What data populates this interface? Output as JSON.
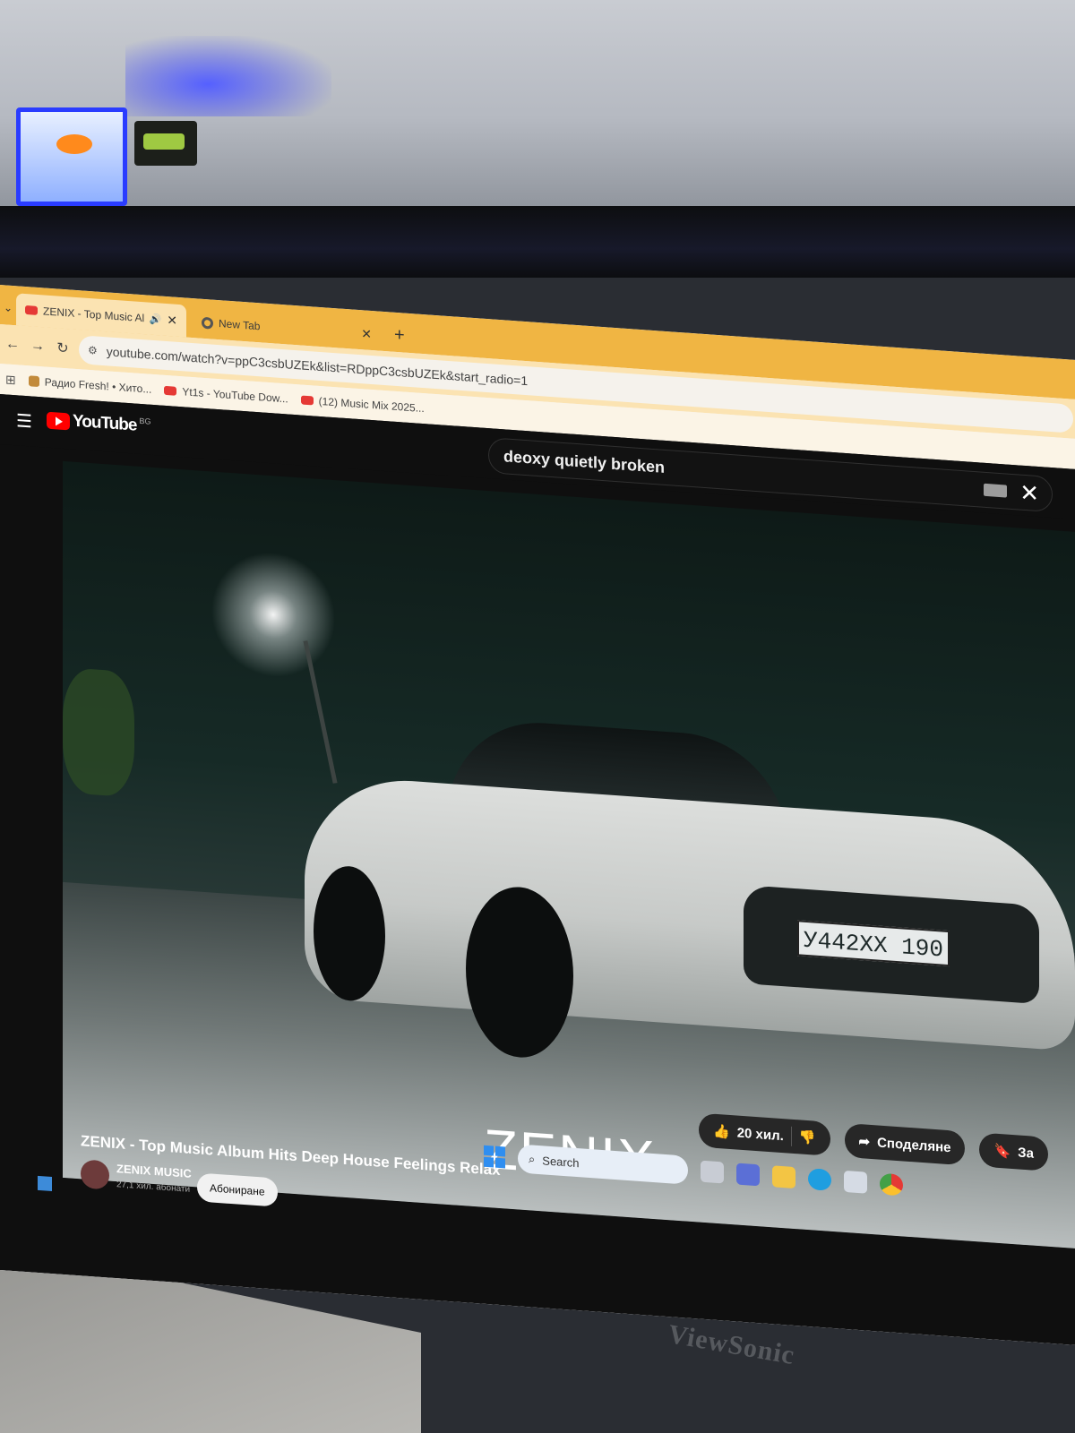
{
  "browser": {
    "tabs": [
      {
        "label": "ZENIX - Top Music Album H",
        "active": true,
        "audio": true
      },
      {
        "label": "New Tab",
        "active": false
      }
    ],
    "url": "youtube.com/watch?v=ppC3csbUZEk&list=RDppC3csbUZEk&start_radio=1",
    "bookmarks": [
      {
        "label": "Радио Fresh! • Хито...",
        "icon": "radio-icon"
      },
      {
        "label": "Yt1s - YouTube Dow...",
        "icon": "youtube-icon"
      },
      {
        "label": "(12) Music Mix 2025...",
        "icon": "youtube-icon"
      }
    ]
  },
  "youtube": {
    "logo_text": "YouTube",
    "country_code": "BG",
    "search_query": "deoxy quietly broken",
    "video": {
      "overlay_text": "ZENIX",
      "plate_text": "У442ХХ 190",
      "title": "ZENIX - Top Music Album Hits Deep House Feelings Relax",
      "channel": "ZENIX MUSIC",
      "subscribers": "27,1 хил. абонати",
      "subscribe_label": "Абониране",
      "likes": "20 хил.",
      "share_label": "Споделяне",
      "save_label": "За"
    }
  },
  "taskbar": {
    "search_label": "Search"
  },
  "monitor": {
    "brand": "ViewSonic"
  },
  "colors": {
    "tabbar": "#f0b543",
    "youtube_red": "#ff0000",
    "page_bg": "#0f0f0f"
  }
}
